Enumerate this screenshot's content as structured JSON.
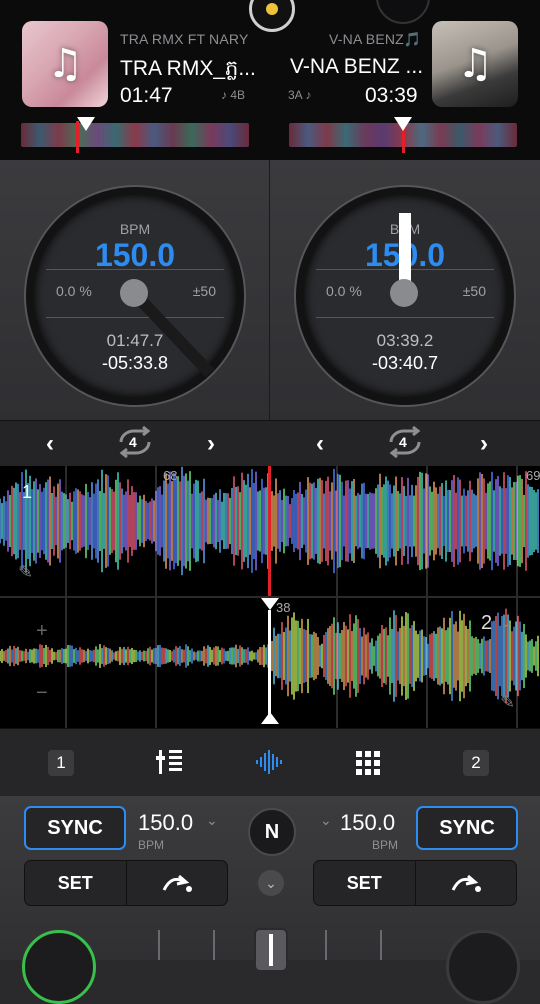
{
  "deck_a": {
    "artist": "TRA RMX FT NARY",
    "title": "TRA RMX_ភ្ល...",
    "elapsed": "01:47",
    "key": "♪ 4B",
    "bpm_label": "BPM",
    "bpm": "150.0",
    "pitch": "0.0 %",
    "range": "±50",
    "time_elapsed": "01:47.7",
    "time_remaining": "-05:33.8",
    "loop_beats": "4",
    "playhead_fraction": 0.28
  },
  "deck_b": {
    "artist": "V-NA BENZ🎵",
    "title": "V-NA BENZ ...",
    "elapsed": "03:39",
    "key": "3A ♪",
    "bpm_label": "BPM",
    "bpm": "150.0",
    "pitch": "0.0 %",
    "range": "±50",
    "time_elapsed": "03:39.2",
    "time_remaining": "-03:40.7",
    "loop_beats": "4",
    "playhead_fraction": 0.5
  },
  "waveform_a": {
    "beat_label_1": "1",
    "beat_label_68": "68",
    "beat_label_69": "69"
  },
  "waveform_b": {
    "beat_label_38": "38",
    "deck_number": "2"
  },
  "toolbar": {
    "deck1": "1",
    "deck2": "2"
  },
  "controls": {
    "sync_label": "SYNC",
    "bpm_left": "150.0",
    "bpm_right": "150.0",
    "bpm_unit": "BPM",
    "set_label": "SET",
    "n_label": "N",
    "dropdown_glyph": "⌄"
  },
  "colors": {
    "accent": "#2d8cf0",
    "playhead": "#e2202a",
    "play_active": "#38c04a"
  }
}
